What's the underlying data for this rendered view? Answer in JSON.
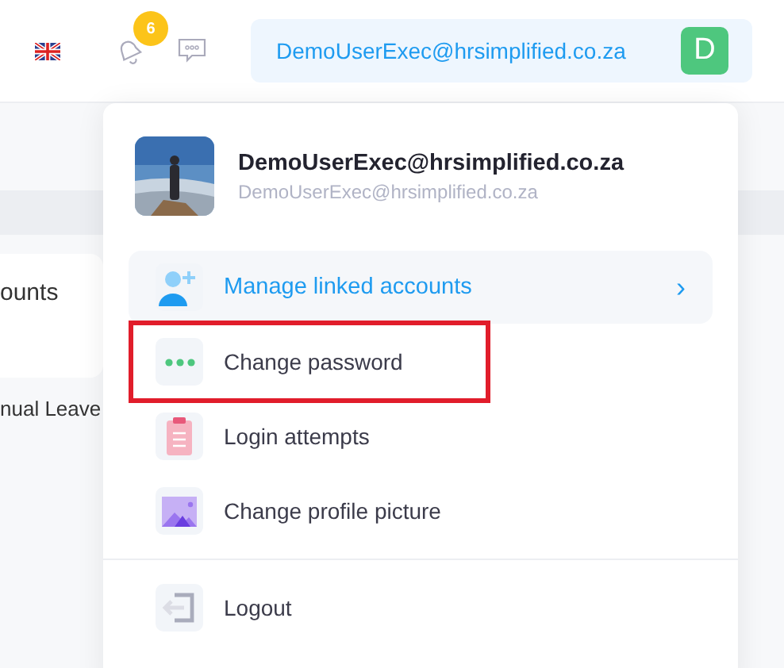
{
  "header": {
    "notifications": {
      "count": "6"
    },
    "account": {
      "email": "DemoUserExec@hrsimplified.co.za",
      "initial": "D"
    }
  },
  "background": {
    "card_text": "ounts",
    "list_text": "nual Leave"
  },
  "menu": {
    "name": "DemoUserExec@hrsimplified.co.za",
    "email": "DemoUserExec@hrsimplified.co.za",
    "items": [
      {
        "kind": "linked",
        "label": "Manage linked accounts",
        "selected": true,
        "outlined": false,
        "chevron": "›"
      },
      {
        "kind": "password",
        "label": "Change password",
        "selected": false,
        "outlined": true
      },
      {
        "kind": "attempts",
        "label": "Login attempts",
        "selected": false,
        "outlined": false
      },
      {
        "kind": "picture",
        "label": "Change profile picture",
        "selected": false,
        "outlined": false
      },
      {
        "kind": "logout",
        "label": "Logout",
        "selected": false,
        "outlined": false
      }
    ]
  }
}
